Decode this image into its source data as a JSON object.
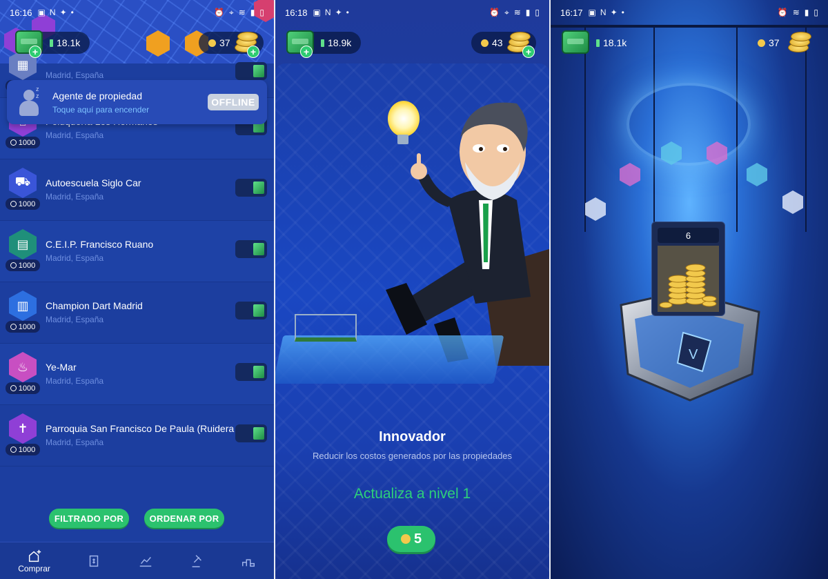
{
  "panel1": {
    "status": {
      "time": "16:16"
    },
    "cash": "18.1k",
    "coins": "37",
    "agent": {
      "title": "Agente de propiedad",
      "subtitle": "Toque aquí para encender",
      "button": "OFFLINE"
    },
    "properties": [
      {
        "name": "",
        "location": "Madrid, España",
        "price": "1000",
        "color": "#6a7fc2",
        "icon": "building-icon"
      },
      {
        "name": "Peluquería Los Hermanos",
        "location": "Madrid, España",
        "price": "1000",
        "color": "#8f3fd6",
        "icon": "barber-icon"
      },
      {
        "name": "Autoescuela Siglo Car",
        "location": "Madrid, España",
        "price": "1000",
        "color": "#3a55d8",
        "icon": "car-icon"
      },
      {
        "name": "C.E.I.P. Francisco Ruano",
        "location": "Madrid, España",
        "price": "1000",
        "color": "#1f8f7a",
        "icon": "school-icon"
      },
      {
        "name": "Champion Dart Madrid",
        "location": "Madrid, España",
        "price": "1000",
        "color": "#2d6fe0",
        "icon": "office-icon"
      },
      {
        "name": "Ye-Mar",
        "location": "Madrid, España",
        "price": "1000",
        "color": "#c84fc2",
        "icon": "spa-icon"
      },
      {
        "name": "Parroquia San Francisco De Paula (Ruidera",
        "location": "Madrid, España",
        "price": "1000",
        "color": "#8f3fd6",
        "icon": "church-icon"
      }
    ],
    "filter_label": "FILTRADO POR",
    "order_label": "ORDENAR POR",
    "nav": {
      "buy_label": "Comprar"
    }
  },
  "panel2": {
    "status": {
      "time": "16:18"
    },
    "cash": "18.9k",
    "coins": "43",
    "achievement": {
      "title": "Innovador",
      "description": "Reducir los costos generados por las propiedades",
      "upgrade": "Actualiza a nivel 1",
      "price": "5"
    }
  },
  "panel3": {
    "status": {
      "time": "16:17"
    },
    "cash": "18.1k",
    "coins": "37",
    "reward_count": "6"
  },
  "colors": {
    "accent_green": "#2bc26e",
    "bg_blue": "#1c3ea0",
    "link_blue": "#7ec3ff"
  }
}
